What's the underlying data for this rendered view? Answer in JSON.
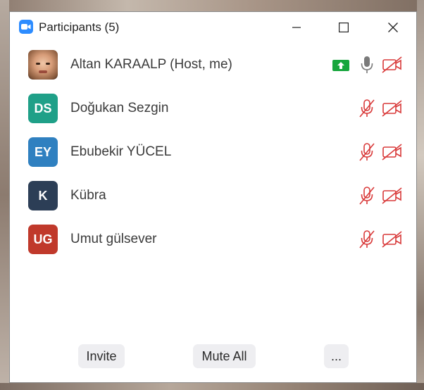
{
  "window": {
    "title": "Participants (5)"
  },
  "participants": [
    {
      "name": "Altan KARAALP (Host, me)",
      "avatar_initials": "",
      "avatar_color": "",
      "sharing": true,
      "mic": "on",
      "video": "off"
    },
    {
      "name": "Doğukan Sezgin",
      "avatar_initials": "DS",
      "avatar_color": "#1fa088",
      "sharing": false,
      "mic": "muted",
      "video": "off"
    },
    {
      "name": "Ebubekir YÜCEL",
      "avatar_initials": "EY",
      "avatar_color": "#2f80c0",
      "sharing": false,
      "mic": "muted",
      "video": "off"
    },
    {
      "name": "Kübra",
      "avatar_initials": "K",
      "avatar_color": "#2c3e56",
      "sharing": false,
      "mic": "muted",
      "video": "off"
    },
    {
      "name": "Umut gülsever",
      "avatar_initials": "UG",
      "avatar_color": "#c0392b",
      "sharing": false,
      "mic": "muted",
      "video": "off"
    }
  ],
  "footer": {
    "invite_label": "Invite",
    "mute_all_label": "Mute All",
    "more_label": "..."
  },
  "colors": {
    "muted_red": "#d93a3a",
    "share_green": "#17a63d",
    "mic_gray": "#7a7a7a",
    "app_blue": "#2d8cff"
  }
}
